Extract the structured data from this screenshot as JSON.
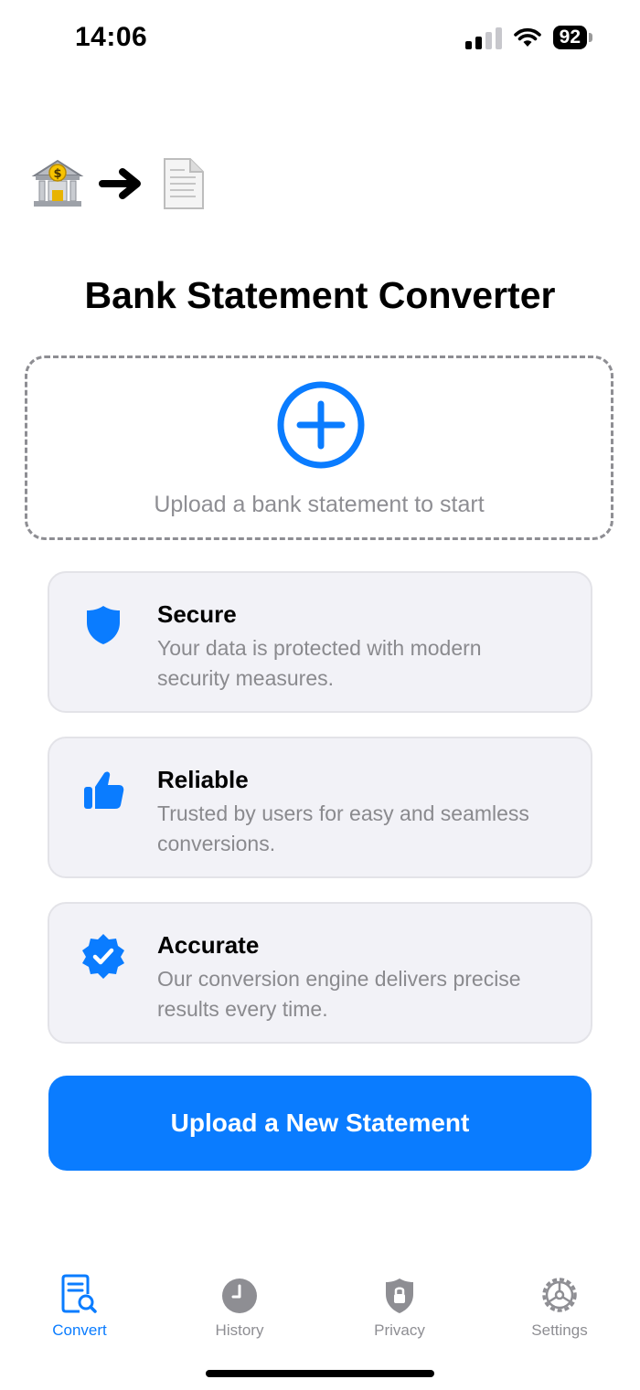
{
  "status_bar": {
    "time": "14:06",
    "battery": "92"
  },
  "title": "Bank Statement Converter",
  "upload": {
    "text": "Upload a bank statement to start"
  },
  "features": [
    {
      "title": "Secure",
      "description": "Your data is protected with modern security measures.",
      "icon": "shield-icon"
    },
    {
      "title": "Reliable",
      "description": "Trusted by users for easy and seamless conversions.",
      "icon": "thumbs-up-icon"
    },
    {
      "title": "Accurate",
      "description": "Our conversion engine delivers precise results every time.",
      "icon": "verified-badge-icon"
    }
  ],
  "cta": {
    "label": "Upload a New Statement"
  },
  "tabs": [
    {
      "label": "Convert",
      "icon": "document-search-icon",
      "active": true
    },
    {
      "label": "History",
      "icon": "clock-icon",
      "active": false
    },
    {
      "label": "Privacy",
      "icon": "lock-shield-icon",
      "active": false
    },
    {
      "label": "Settings",
      "icon": "gear-icon",
      "active": false
    }
  ],
  "colors": {
    "accent": "#0a7cff",
    "secondary_text": "#8e8e93",
    "card_bg": "#f2f2f7"
  }
}
